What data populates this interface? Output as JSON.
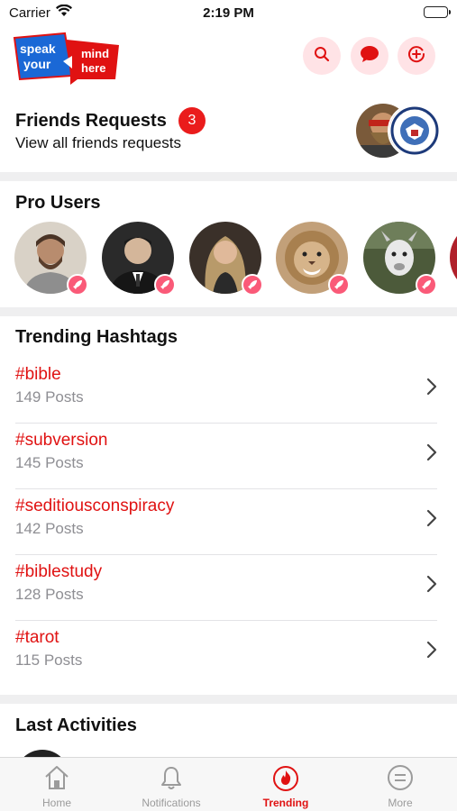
{
  "status_bar": {
    "carrier": "Carrier",
    "time": "2:19 PM"
  },
  "logo": {
    "line1": "speak",
    "line2": "your",
    "line3": "mind",
    "line4": "here"
  },
  "header": {
    "icons": [
      "search-icon",
      "chat-bubble-icon",
      "add-post-icon"
    ],
    "accent_color": "#e01212",
    "icon_bg_color": "#ffe3e6"
  },
  "friend_requests": {
    "title": "Friends Requests",
    "badge_count": "3",
    "subtitle": "View all friends requests"
  },
  "pro_users": {
    "title": "Pro Users",
    "users": [
      {
        "avatar": "bearded-man-photo"
      },
      {
        "avatar": "man-in-suit-photo"
      },
      {
        "avatar": "woman-blonde-photo"
      },
      {
        "avatar": "lion-photo"
      },
      {
        "avatar": "cartoon-goat-photo"
      },
      {
        "avatar": "partial-avatar"
      }
    ]
  },
  "trending_hashtags": {
    "title": "Trending Hashtags",
    "items": [
      {
        "tag": "#bible",
        "posts": "149 Posts"
      },
      {
        "tag": "#subversion",
        "posts": "145 Posts"
      },
      {
        "tag": "#seditiousconspiracy",
        "posts": "142 Posts"
      },
      {
        "tag": "#biblestudy",
        "posts": "128 Posts"
      },
      {
        "tag": "#tarot",
        "posts": "115 Posts"
      }
    ]
  },
  "last_activities": {
    "title": "Last Activities"
  },
  "tabbar": {
    "tabs": [
      {
        "label": "Home",
        "icon": "home-icon"
      },
      {
        "label": "Notifications",
        "icon": "bell-icon"
      },
      {
        "label": "Trending",
        "icon": "flame-icon",
        "active": true
      },
      {
        "label": "More",
        "icon": "more-icon"
      }
    ]
  }
}
